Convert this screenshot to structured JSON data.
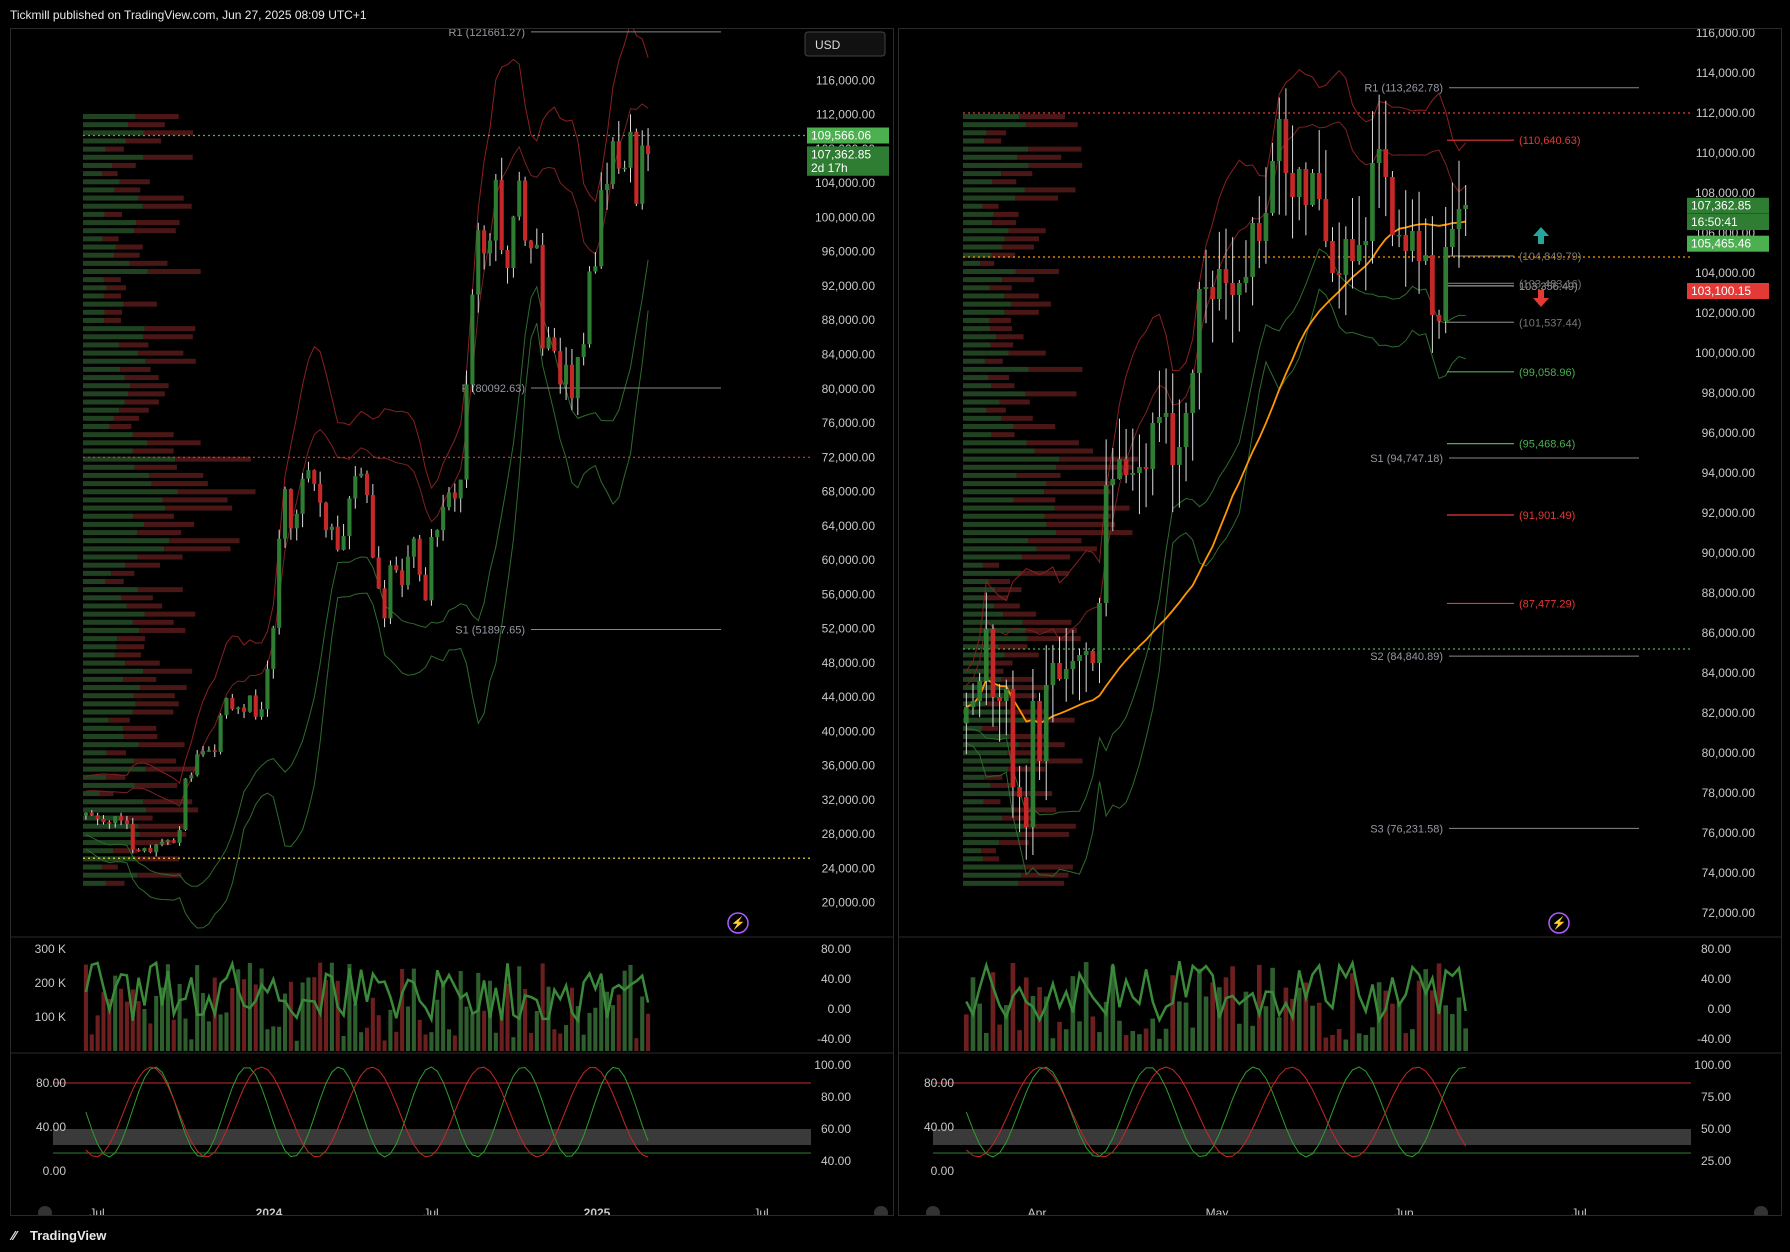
{
  "header": {
    "published": "Tickmill published on TradingView.com, Jun 27, 2025 08:09 UTC+1"
  },
  "footer": {
    "brand": "TradingView"
  },
  "colors": {
    "up": "#2e7d32",
    "down": "#c62828",
    "bg": "#000000",
    "upLabel": "#4caf50",
    "downLabel": "#e53935",
    "orange": "#ff9800"
  },
  "icons": [
    "lightning-icon",
    "arrow-up-icon",
    "arrow-down-icon",
    "tradingview-logo-icon"
  ],
  "chart_data": [
    {
      "type": "candlestick",
      "panel": "left",
      "currency_button": "USD",
      "y_ticks": [
        "116,000.00",
        "112,000.00",
        "108,000.00",
        "104,000.00",
        "100,000.00",
        "96,000.00",
        "92,000.00",
        "88,000.00",
        "84,000.00",
        "80,000.00",
        "76,000.00",
        "72,000.00",
        "68,000.00",
        "64,000.00",
        "60,000.00",
        "56,000.00",
        "52,000.00",
        "48,000.00",
        "44,000.00",
        "40,000.00",
        "36,000.00",
        "32,000.00",
        "28,000.00",
        "24,000.00",
        "20,000.00"
      ],
      "ylim": [
        16000,
        122000
      ],
      "x_ticks": [
        "Jul",
        "2024",
        "Jul",
        "2025",
        "Jul"
      ],
      "price_labels": [
        {
          "text": "109,566.06",
          "value": 109566.06,
          "color": "#4caf50"
        },
        {
          "text": "107,362.85",
          "value": 107362.85,
          "color": "#2e7d32"
        },
        {
          "text": "2d 17h",
          "value": 105800,
          "color": "#2e7d32"
        }
      ],
      "pivots": [
        {
          "text": "R1 (121661.27)",
          "value": 121661.27
        },
        {
          "text": "P (80092.63)",
          "value": 80092.63
        },
        {
          "text": "S1 (51897.65)",
          "value": 51897.65
        }
      ],
      "weekly_closes": [
        30500,
        30200,
        29800,
        29400,
        29300,
        30100,
        29600,
        29200,
        26200,
        26000,
        26400,
        25900,
        26800,
        27100,
        27300,
        27000,
        28500,
        34500,
        34900,
        37300,
        37700,
        37800,
        37600,
        41900,
        43900,
        42600,
        42800,
        42300,
        44200,
        41700,
        42600,
        47300,
        52100,
        62500,
        68300,
        63700,
        65400,
        69500,
        70500,
        68900,
        66700,
        63500,
        63900,
        61200,
        62800,
        67200,
        69800,
        70100,
        67600,
        60300,
        56700,
        53200,
        59400,
        58800,
        57100,
        60400,
        62500,
        58300,
        55300,
        62700,
        63500,
        66200,
        67900,
        67200,
        69400,
        80500,
        91000,
        98500,
        95800,
        97300,
        104400,
        96200,
        94100,
        100100,
        104300,
        97300,
        96400,
        96800,
        84700,
        86000,
        84400,
        80500,
        82800,
        78900,
        83700,
        85200,
        93700,
        94300,
        103200,
        103900,
        108900,
        105700,
        105800,
        110000,
        101600,
        108400,
        107400
      ],
      "volume_axis": [
        "300 K",
        "200 K",
        "100 K"
      ],
      "rsi_axis_left": [
        "80.00",
        "40.00",
        "0.00"
      ],
      "rsi_axis_right": [
        "80.00",
        "40.00",
        "0.00",
        "-40.00"
      ],
      "stoch_axis_left": [
        "80.00",
        "40.00",
        "0.00"
      ],
      "stoch_axis_right": [
        "100.00",
        "80.00",
        "60.00",
        "40.00"
      ]
    },
    {
      "type": "candlestick",
      "panel": "right",
      "y_ticks": [
        "116,000.00",
        "114,000.00",
        "112,000.00",
        "110,000.00",
        "108,000.00",
        "106,000.00",
        "104,000.00",
        "102,000.00",
        "100,000.00",
        "98,000.00",
        "96,000.00",
        "94,000.00",
        "92,000.00",
        "90,000.00",
        "88,000.00",
        "86,000.00",
        "84,000.00",
        "82,000.00",
        "80,000.00",
        "78,000.00",
        "76,000.00",
        "74,000.00",
        "72,000.00"
      ],
      "ylim": [
        70800,
        116200
      ],
      "x_ticks": [
        "Apr",
        "May",
        "Jun",
        "Jul"
      ],
      "price_labels": [
        {
          "text": "107,362.85",
          "value": 107362.85,
          "color": "#2e7d32"
        },
        {
          "text": "16:50:41",
          "value": 106550,
          "color": "#2e7d32"
        },
        {
          "text": "105,465.46",
          "value": 105465.46,
          "color": "#4caf50"
        },
        {
          "text": "103,100.15",
          "value": 103100.15,
          "color": "#e53935"
        }
      ],
      "pivots": [
        {
          "text": "R1 (113,262.78)",
          "value": 113262.78
        },
        {
          "text": "S1 (94,747.18)",
          "value": 94747.18
        },
        {
          "text": "S2 (84,840.89)",
          "value": 84840.89
        },
        {
          "text": "S3 (76,231.58)",
          "value": 76231.58
        }
      ],
      "levels": [
        {
          "text": "(110,640.63)",
          "value": 110640.63,
          "color": "#e53935"
        },
        {
          "text": "(104,849.79)",
          "value": 104849.79,
          "color": "#777777"
        },
        {
          "text": "103,356.49)",
          "value": 103356.49,
          "color": "#999999"
        },
        {
          "text": "(103,483.16)",
          "value": 103483.16,
          "color": "#777777"
        },
        {
          "text": "(101,537.44)",
          "value": 101537.44,
          "color": "#777777"
        },
        {
          "text": "(99,058.96)",
          "value": 99058.96,
          "color": "#4caf50"
        },
        {
          "text": "(95,468.64)",
          "value": 95468.64,
          "color": "#4caf50"
        },
        {
          "text": "(91,901.49)",
          "value": 91901.49,
          "color": "#e53935"
        },
        {
          "text": "(87,477.29)",
          "value": 87477.29,
          "color": "#e53935"
        }
      ],
      "daily_closes": [
        82300,
        82600,
        83600,
        86200,
        82800,
        82600,
        83200,
        78300,
        77800,
        76300,
        82600,
        79600,
        83400,
        84500,
        83700,
        84200,
        84600,
        84900,
        85100,
        84500,
        87500,
        93400,
        93700,
        94700,
        93900,
        94000,
        94300,
        94200,
        96500,
        96800,
        97000,
        94400,
        95300,
        97000,
        99000,
        103200,
        103300,
        102700,
        104200,
        103500,
        102900,
        103500,
        103800,
        106500,
        105600,
        107000,
        109600,
        111700,
        109000,
        107800,
        109200,
        107400,
        109000,
        107700,
        105600,
        104000,
        103900,
        105700,
        104600,
        105400,
        105600,
        109500,
        110200,
        108800,
        105900,
        105900,
        105100,
        106100,
        104600,
        104900,
        101900,
        101600,
        105300,
        106200,
        107200,
        107400
      ]
    }
  ]
}
